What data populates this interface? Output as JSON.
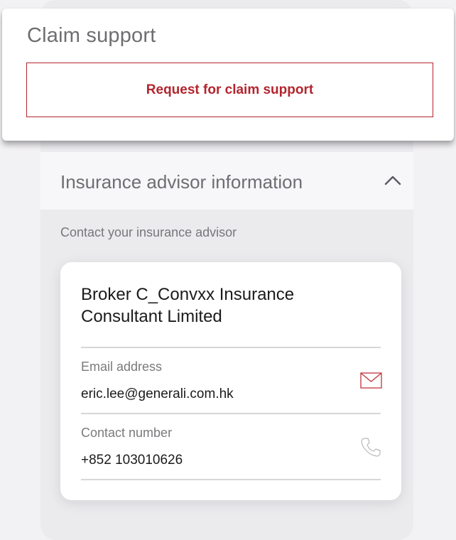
{
  "claim_support": {
    "title": "Claim support",
    "button_label": "Request for claim support"
  },
  "advisor_section": {
    "title": "Insurance advisor information",
    "expanded": true,
    "subtitle": "Contact your insurance advisor",
    "card": {
      "company_name": "Broker C_Convxx Insurance Consultant Limited",
      "email": {
        "label": "Email address",
        "value": "eric.lee@generali.com.hk",
        "icon": "envelope-icon"
      },
      "phone": {
        "label": "Contact number",
        "value": "+852 103010626",
        "icon": "phone-icon"
      }
    }
  },
  "colors": {
    "accent_red": "#b4252e",
    "muted_text": "#6e6e72",
    "background": "#f2f1f3"
  }
}
